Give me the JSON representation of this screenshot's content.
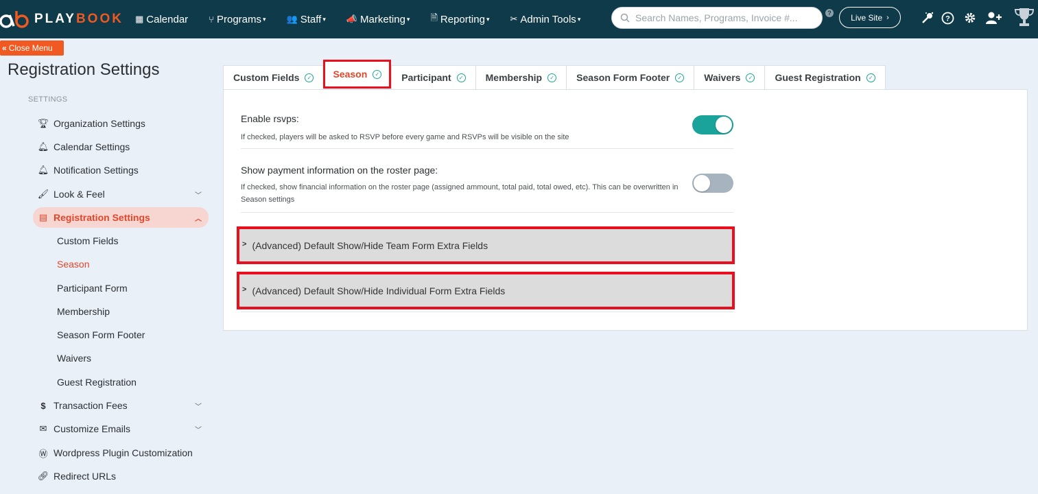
{
  "brand": {
    "play": "PLAY",
    "book": "BOOK"
  },
  "nav": {
    "items": [
      {
        "label": "Calendar",
        "icon": "calendar-icon",
        "caret": false
      },
      {
        "label": "Programs",
        "icon": "programs-icon",
        "caret": true
      },
      {
        "label": "Staff",
        "icon": "staff-icon",
        "caret": true
      },
      {
        "label": "Marketing",
        "icon": "megaphone-icon",
        "caret": true
      },
      {
        "label": "Reporting",
        "icon": "document-icon",
        "caret": true
      },
      {
        "label": "Admin Tools",
        "icon": "tools-icon",
        "caret": true
      }
    ],
    "search_placeholder": "Search Names, Programs, Invoice #...",
    "live_site_label": "Live Site"
  },
  "close_menu_label": "Close Menu",
  "page_title": "Registration Settings",
  "sidebar": {
    "section_label": "SETTINGS",
    "items": [
      {
        "label": "Organization Settings",
        "icon": "trophy-icon"
      },
      {
        "label": "Calendar Settings",
        "icon": "bell-icon"
      },
      {
        "label": "Notification Settings",
        "icon": "bell-icon"
      },
      {
        "label": "Look & Feel",
        "icon": "brush-icon"
      },
      {
        "label": "Registration Settings",
        "icon": "form-icon"
      },
      {
        "label": "Transaction Fees",
        "icon": "dollar-icon"
      },
      {
        "label": "Customize Emails",
        "icon": "mail-icon"
      },
      {
        "label": "Wordpress Plugin Customization",
        "icon": "wordpress-icon"
      },
      {
        "label": "Redirect URLs",
        "icon": "link-icon"
      }
    ],
    "sub_items": [
      {
        "label": "Custom Fields"
      },
      {
        "label": "Season"
      },
      {
        "label": "Participant Form"
      },
      {
        "label": "Membership"
      },
      {
        "label": "Season Form Footer"
      },
      {
        "label": "Waivers"
      },
      {
        "label": "Guest Registration"
      }
    ]
  },
  "tabs": [
    {
      "label": "Custom Fields"
    },
    {
      "label": "Season"
    },
    {
      "label": "Participant"
    },
    {
      "label": "Membership"
    },
    {
      "label": "Season Form Footer"
    },
    {
      "label": "Waivers"
    },
    {
      "label": "Guest Registration"
    }
  ],
  "settings": {
    "rsvp": {
      "label": "Enable rsvps:",
      "description": "If checked, players will be asked to RSVP before every game and RSVPs will be visible on the site",
      "enabled": true
    },
    "payment": {
      "label": "Show payment information on the roster page:",
      "description": "If checked, show financial information on the roster page (assigned ammount, total paid, total owed, etc). This can be overwritten in Season settings",
      "enabled": false
    }
  },
  "advanced": {
    "team": "(Advanced) Default Show/Hide Team Form Extra Fields",
    "individual": "(Advanced) Default Show/Hide Individual Form Extra Fields"
  },
  "colors": {
    "brand_orange": "#f05a22",
    "nav_bg": "#0f3a49",
    "accent_teal": "#1aa39a",
    "highlight_red": "#e8101f"
  }
}
